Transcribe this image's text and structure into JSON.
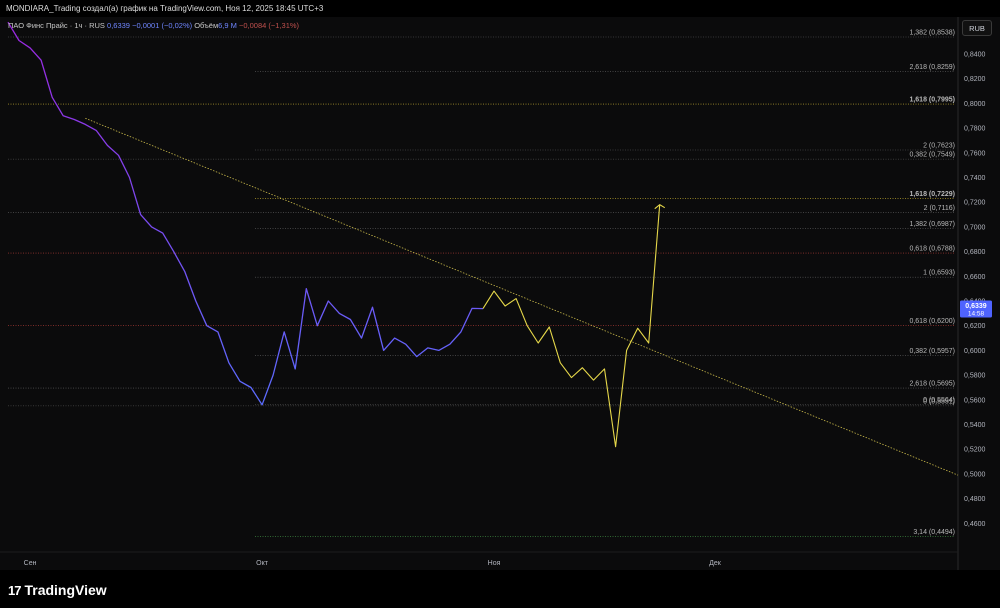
{
  "header": {
    "caption": "MONDIARA_Trading создал(а) график на TradingView.com, Ноя 12, 2025 18:45 UTC+3"
  },
  "symbol": {
    "name": "ПАО Финс Прайс · 1ч · RUS",
    "price": "0,6339",
    "change": "−0,0001 (−0,02%)",
    "volume_label": "Объём",
    "volume_value": "6,9 М",
    "volume_change": "−0,0084 (−1,31%)"
  },
  "currency_button": "RUB",
  "logo": {
    "mark": "17",
    "text": "TradingView"
  },
  "colors": {
    "price_line_top": "#9c27e0",
    "price_line_bottom": "#5b6cff",
    "projection": "#e6d84a",
    "trendline": "#c8b84a",
    "fib_level": "#6c6c6c",
    "fib_highlight": "#f0d23a",
    "fib_red": "#d2453f",
    "fib_green": "#4caf50",
    "price_tag": "#4f63ff"
  },
  "chart_data": {
    "type": "line",
    "series": [
      {
        "values": [
          [
            0,
            0.8658
          ],
          [
            1,
            0.851
          ],
          [
            2,
            0.845
          ],
          [
            3,
            0.835
          ],
          [
            4,
            0.805
          ],
          [
            5,
            0.79
          ],
          [
            6,
            0.787
          ],
          [
            7,
            0.783
          ],
          [
            8,
            0.778
          ],
          [
            9,
            0.766
          ],
          [
            10,
            0.758
          ],
          [
            11,
            0.74
          ],
          [
            12,
            0.71
          ],
          [
            13,
            0.7
          ],
          [
            14,
            0.695
          ],
          [
            15,
            0.68
          ],
          [
            16,
            0.664
          ],
          [
            17,
            0.64
          ],
          [
            18,
            0.62
          ],
          [
            19,
            0.615
          ],
          [
            20,
            0.59
          ],
          [
            21,
            0.575
          ],
          [
            22,
            0.57
          ],
          [
            23,
            0.556
          ],
          [
            24,
            0.58
          ],
          [
            25,
            0.615
          ],
          [
            26,
            0.585
          ],
          [
            27,
            0.65
          ],
          [
            28,
            0.62
          ],
          [
            29,
            0.64
          ],
          [
            30,
            0.63
          ],
          [
            31,
            0.625
          ],
          [
            32,
            0.61
          ],
          [
            33,
            0.635
          ],
          [
            34,
            0.6
          ],
          [
            35,
            0.61
          ],
          [
            36,
            0.605
          ],
          [
            37,
            0.595
          ],
          [
            38,
            0.602
          ],
          [
            39,
            0.6
          ],
          [
            40,
            0.605
          ],
          [
            41,
            0.615
          ],
          [
            42,
            0.634
          ],
          [
            43,
            0.6339
          ]
        ]
      },
      {
        "values": [
          [
            43,
            0.6339
          ],
          [
            44,
            0.648
          ],
          [
            45,
            0.636
          ],
          [
            46,
            0.642
          ],
          [
            47,
            0.62
          ],
          [
            48,
            0.606
          ],
          [
            49,
            0.619
          ],
          [
            50,
            0.59
          ],
          [
            51,
            0.578
          ],
          [
            52,
            0.586
          ],
          [
            53,
            0.576
          ],
          [
            54,
            0.585
          ],
          [
            55,
            0.522
          ],
          [
            56,
            0.6
          ],
          [
            57,
            0.618
          ],
          [
            58,
            0.606
          ],
          [
            59,
            0.718
          ]
        ]
      }
    ],
    "trendline": {
      "from": [
        7,
        0.788
      ],
      "to": [
        86,
        0.499
      ]
    },
    "fib_levels": [
      {
        "label": "1,382 (0,8538)",
        "value": 0.8538,
        "style": "normal"
      },
      {
        "label": "2,618 (0,8259)",
        "value": 0.8259,
        "style": "normal"
      },
      {
        "label": "1,618 (0,7995)",
        "value": 0.7995,
        "style": "yellow"
      },
      {
        "label": "2 (0,7623)",
        "value": 0.7623,
        "style": "normal"
      },
      {
        "label": "0,382 (0,7549)",
        "value": 0.7549,
        "style": "normal"
      },
      {
        "label": "1,618 (0,7229)",
        "value": 0.7229,
        "style": "yellow"
      },
      {
        "label": "2 (0,7116)",
        "value": 0.7116,
        "style": "normal"
      },
      {
        "label": "1,382 (0,6987)",
        "value": 0.6987,
        "style": "normal"
      },
      {
        "label": "0,618 (0,6788)",
        "value": 0.6788,
        "style": "red"
      },
      {
        "label": "1 (0,6593)",
        "value": 0.6593,
        "style": "normal"
      },
      {
        "label": "0,618 (0,6200)",
        "value": 0.62,
        "style": "red"
      },
      {
        "label": "0,382 (0,5957)",
        "value": 0.5957,
        "style": "normal"
      },
      {
        "label": "2,618 (0,5695)",
        "value": 0.5695,
        "style": "normal"
      },
      {
        "label": "0 (0,5564)",
        "value": 0.5564,
        "style": "normal"
      },
      {
        "label": "0 (0,5551)",
        "value": 0.5551,
        "style": "normal"
      },
      {
        "label": "3,14 (0,4494)",
        "value": 0.4494,
        "style": "green"
      }
    ],
    "price_tag": {
      "price": "0,6339",
      "time": "14:58",
      "value": 0.6339
    },
    "y_ticks": [
      "0,8400",
      "0,8200",
      "0,8000",
      "0,7800",
      "0,7600",
      "0,7400",
      "0,7200",
      "0,7000",
      "0,6800",
      "0,6600",
      "0,6400",
      "0,6200",
      "0,6000",
      "0,5800",
      "0,5600",
      "0,5400",
      "0,5200",
      "0,5000",
      "0,4800",
      "0,4600"
    ],
    "y_tick_values": [
      0.84,
      0.82,
      0.8,
      0.78,
      0.76,
      0.74,
      0.72,
      0.7,
      0.68,
      0.66,
      0.64,
      0.62,
      0.6,
      0.58,
      0.56,
      0.54,
      0.52,
      0.5,
      0.48,
      0.46
    ],
    "x_ticks": [
      {
        "label": "Сен",
        "x": 2
      },
      {
        "label": "Окт",
        "x": 23
      },
      {
        "label": "Ноя",
        "x": 44
      },
      {
        "label": "Дек",
        "x": 64
      }
    ],
    "xlim": [
      0,
      86
    ],
    "ylim": [
      0.44,
      0.87
    ]
  }
}
